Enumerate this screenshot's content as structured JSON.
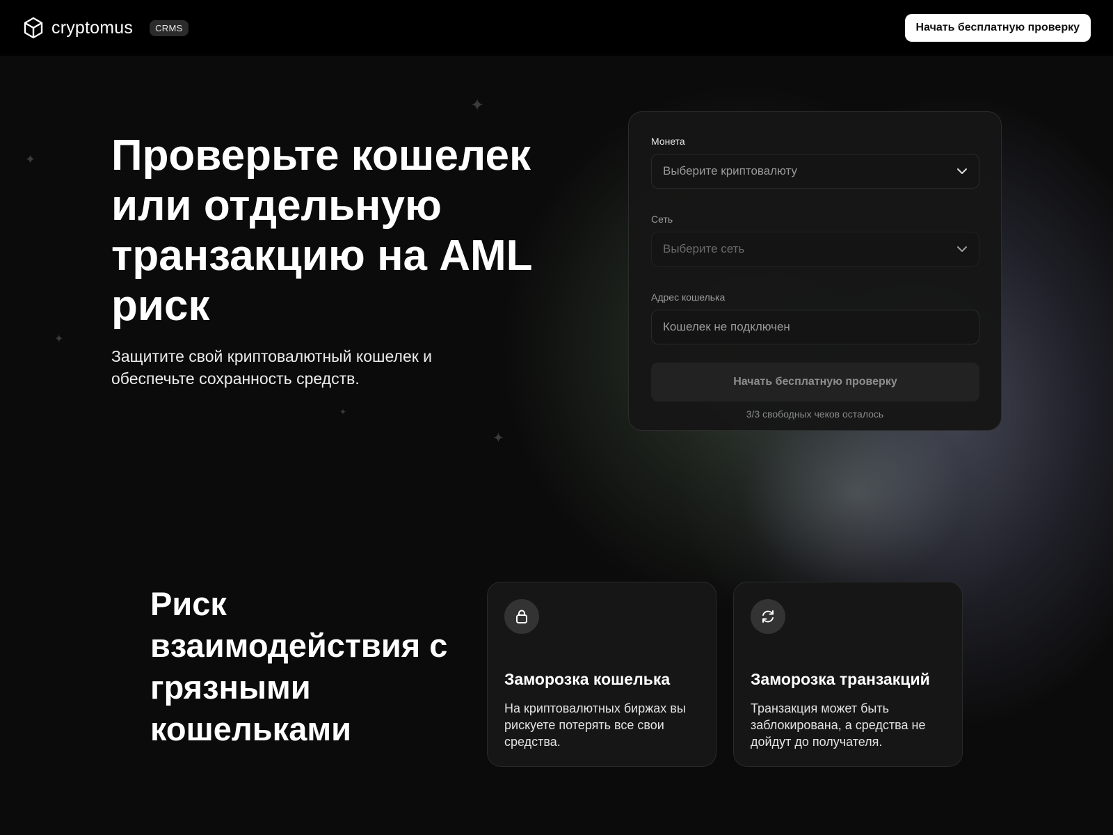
{
  "header": {
    "brand": "cryptomus",
    "badge": "CRMS",
    "cta_label": "Начать бесплатную проверку"
  },
  "hero": {
    "title": "Проверьте кошелек или отдельную транзакцию на AML риск",
    "subtitle": "Защитите свой криптовалютный кошелек и обеспечьте сохранность средств."
  },
  "form": {
    "coin": {
      "label": "Монета",
      "placeholder": "Выберите криптовалюту"
    },
    "network": {
      "label": "Сеть",
      "placeholder": "Выберите сеть"
    },
    "wallet": {
      "label": "Адрес кошелька",
      "placeholder": "Кошелек не подключен"
    },
    "submit_label": "Начать бесплатную проверку",
    "remaining": "3/3 свободных чеков осталось"
  },
  "risk": {
    "title": "Риск взаимодействия с грязными кошельками",
    "cards": [
      {
        "icon": "lock-icon",
        "title": "Заморозка кошелька",
        "text": "На криптовалютных биржах вы рискуете потерять все свои средства."
      },
      {
        "icon": "refresh-icon",
        "title": "Заморозка транзакций",
        "text": "Транзакция может быть заблокирована, а средства не дойдут до получателя."
      }
    ]
  },
  "colors": {
    "background": "#0c0c0c",
    "header_bg": "#000000",
    "card_bg": "#161616",
    "cta_bg": "#ffffff"
  }
}
